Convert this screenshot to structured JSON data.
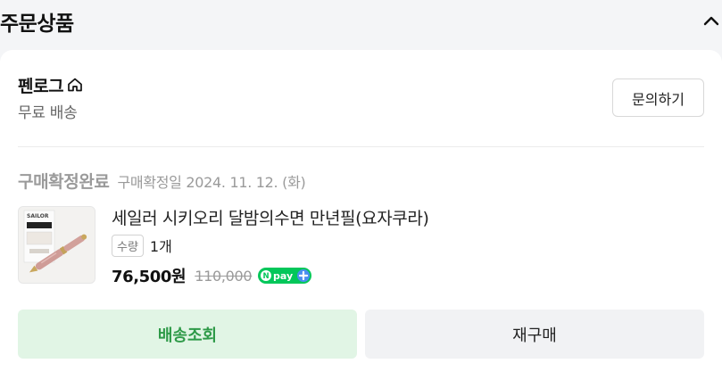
{
  "section": {
    "title": "주문상품"
  },
  "order": {
    "shop_name": "펜로그",
    "shipping": "무료 배송",
    "inquiry_label": "문의하기",
    "status": "구매확정완료",
    "status_date": "구매확정일 2024. 11. 12. (화)",
    "product": {
      "name": "세일러 시키오리 달밤의수면 만년필(요자쿠라)",
      "thumbnail_brand": "SAILOR",
      "qty_label": "수량",
      "qty_value": "1개",
      "price": "76,500원",
      "original_price": "110,000",
      "badge": "pay"
    },
    "actions": {
      "track_label": "배송조회",
      "rebuy_label": "재구매"
    }
  },
  "colors": {
    "accent_green": "#2e9a48",
    "npay_green": "#03c75a",
    "npay_blue": "#4a8ff0"
  }
}
